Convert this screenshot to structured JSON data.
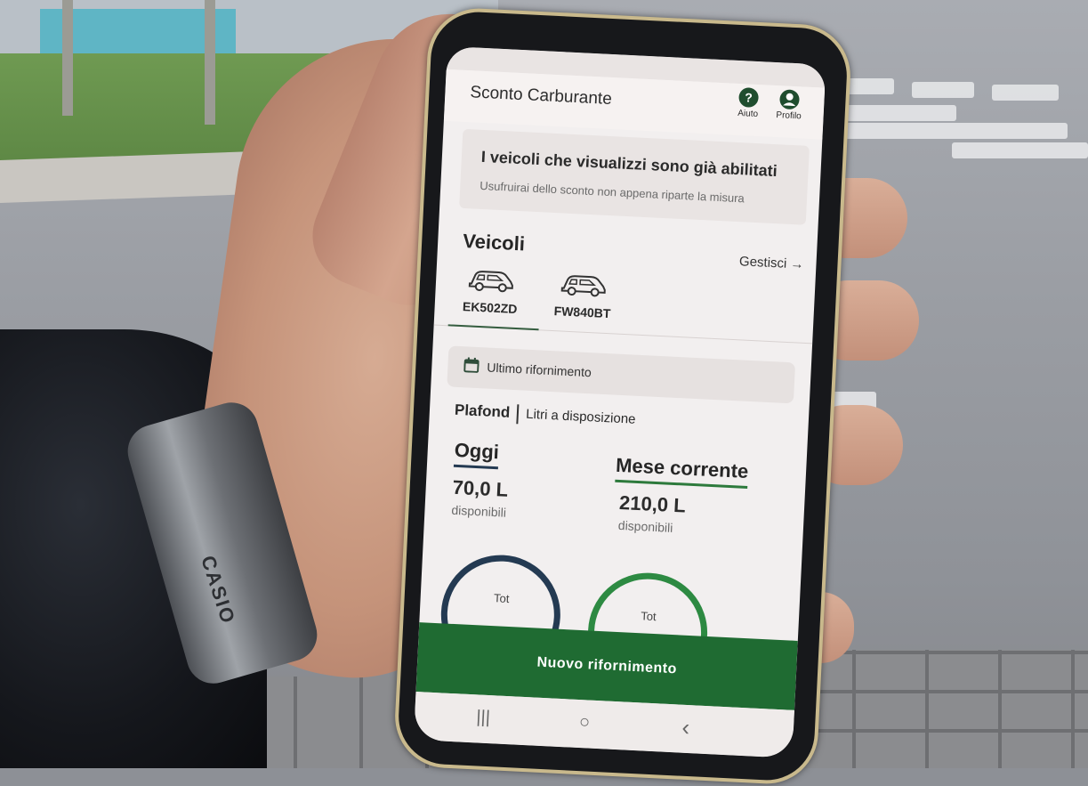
{
  "app": {
    "title": "Sconto Carburante"
  },
  "header": {
    "help": {
      "icon": "help-icon",
      "glyph": "?",
      "label": "Aiuto"
    },
    "profile": {
      "icon": "profile-icon",
      "label": "Profilo"
    }
  },
  "info_card": {
    "title": "I veicoli che visualizzi sono già abilitati",
    "subtitle": "Usufruirai dello sconto non appena riparte la misura"
  },
  "vehicles": {
    "title": "Veicoli",
    "manage_label": "Gestisci →",
    "items": [
      {
        "plate": "EK502ZD",
        "icon": "car-icon",
        "selected": true
      },
      {
        "plate": "FW840BT",
        "icon": "car-icon",
        "selected": false
      }
    ]
  },
  "last_refuel": {
    "icon": "calendar-icon",
    "label": "Ultimo rifornimento"
  },
  "plafond": {
    "label": "Plafond",
    "sublabel": "Litri a disposizione"
  },
  "stats": {
    "today": {
      "title": "Oggi",
      "value": "70,0 L",
      "unit": "disponibili",
      "accent": "#243a52"
    },
    "month": {
      "title": "Mese corrente",
      "value": "210,0 L",
      "unit": "disponibili",
      "accent": "#2d7a3c"
    }
  },
  "gauges": {
    "today_label": "Tot",
    "month_label": "Tot"
  },
  "cta": {
    "label": "Nuovo rifornimento",
    "color": "#1f6b32"
  },
  "navbar": {
    "recent": "|||",
    "home": "○",
    "back": "‹"
  },
  "watch": {
    "brand": "CASIO"
  }
}
